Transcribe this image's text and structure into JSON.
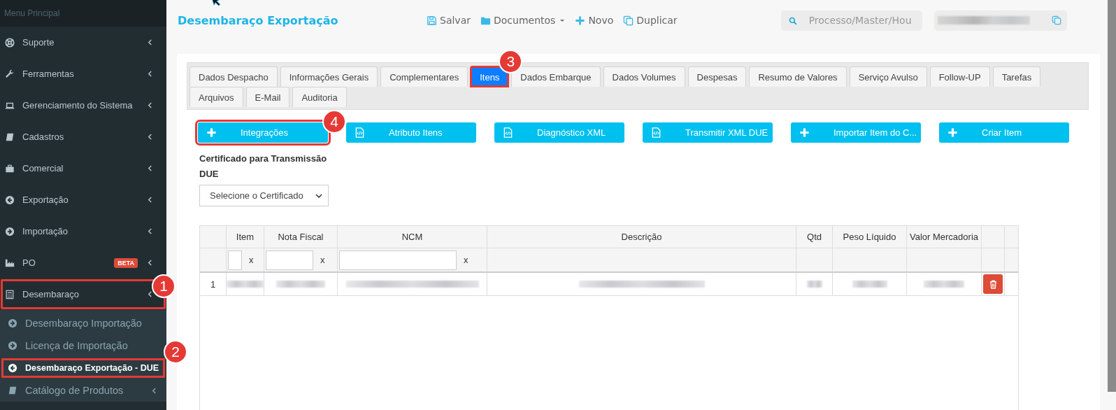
{
  "sidebar": {
    "header": "Menu Principal",
    "items": [
      {
        "label": "Suporte"
      },
      {
        "label": "Ferramentas"
      },
      {
        "label": "Gerenciamento do Sistema"
      },
      {
        "label": "Cadastros"
      },
      {
        "label": "Comercial"
      },
      {
        "label": "Exportação"
      },
      {
        "label": "Importação"
      },
      {
        "label": "PO",
        "badge": "BETA"
      },
      {
        "label": "Desembaraço",
        "callout": "1",
        "children": [
          {
            "label": "Desembaraço Importação",
            "selected": false
          },
          {
            "label": "Licença de Importação",
            "selected": false
          },
          {
            "label": "Desembaraço Exportação - DUE",
            "selected": true,
            "callout": "2"
          },
          {
            "label": "Catálogo de Produtos",
            "selected": false
          }
        ]
      }
    ]
  },
  "header": {
    "title": "Desembaraço Exportação",
    "toolbar": [
      {
        "label": "Salvar"
      },
      {
        "label": "Documentos"
      },
      {
        "label": "Novo"
      },
      {
        "label": "Duplicar"
      }
    ],
    "search": {
      "placeholder": "Processo/Master/Hou"
    }
  },
  "tabs": [
    {
      "label": "Dados Despacho",
      "selected": false
    },
    {
      "label": "Informações Gerais",
      "selected": false
    },
    {
      "label": "Complementares",
      "selected": false
    },
    {
      "label": "Itens",
      "selected": true,
      "callout": "3"
    },
    {
      "label": "Dados Embarque",
      "selected": false
    },
    {
      "label": "Dados Volumes",
      "selected": false
    },
    {
      "label": "Despesas",
      "selected": false
    },
    {
      "label": "Resumo de Valores",
      "selected": false
    },
    {
      "label": "Serviço Avulso",
      "selected": false
    },
    {
      "label": "Follow-UP",
      "selected": false
    },
    {
      "label": "Tarefas",
      "selected": false
    },
    {
      "label": "Arquivos",
      "selected": false
    },
    {
      "label": "E-Mail",
      "selected": false
    },
    {
      "label": "Auditoria",
      "selected": false
    }
  ],
  "actions": [
    {
      "label": "Integrações",
      "kind": "add",
      "callout": "4"
    },
    {
      "label": "Atributo Itens",
      "kind": "code"
    },
    {
      "label": "Diagnóstico XML",
      "kind": "code"
    },
    {
      "label": "Transmitir XML DUE",
      "kind": "code"
    },
    {
      "label": "Importar Item do C...",
      "kind": "add"
    },
    {
      "label": "Criar Item",
      "kind": "add"
    }
  ],
  "certificate": {
    "label": "Certificado para Transmissão DUE",
    "value": "Selecione o Certificado"
  },
  "table": {
    "columns": [
      {
        "label": "Item",
        "clear": "x"
      },
      {
        "label": "Nota Fiscal",
        "clear": "x"
      },
      {
        "label": "NCM",
        "clear": "x"
      },
      {
        "label": "Descrição"
      },
      {
        "label": "Qtd"
      },
      {
        "label": "Peso Líquido"
      },
      {
        "label": "Valor Mercadoria"
      }
    ],
    "rows": [
      {
        "index": "1"
      }
    ]
  }
}
